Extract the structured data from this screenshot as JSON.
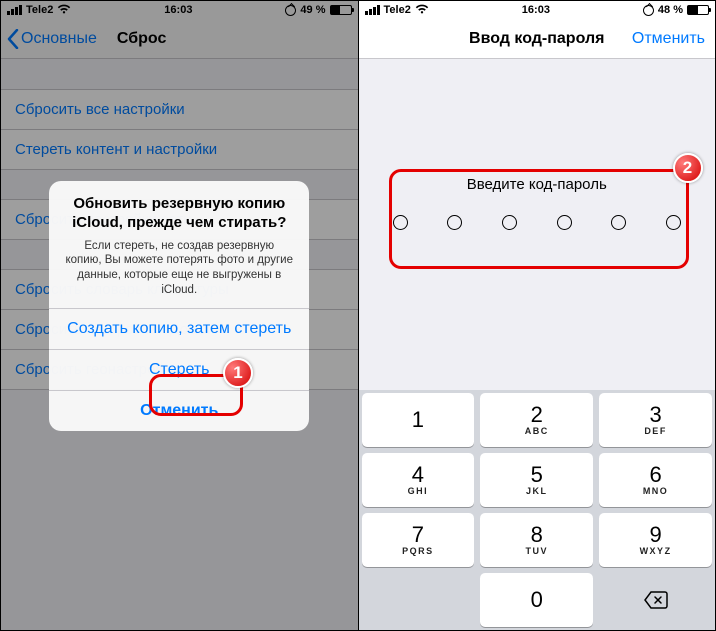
{
  "left": {
    "status": {
      "carrier": "Tele2",
      "time": "16:03",
      "battery_pct": "49 %"
    },
    "nav": {
      "back": "Основные",
      "title": "Сброс"
    },
    "list": {
      "group1": [
        "Сбросить все настройки",
        "Стереть контент и настройки"
      ],
      "group2": [
        "Сбросить настройки сети"
      ],
      "group3": [
        "Сбросить словарь клавиатуры",
        "Сбросить настройки «Домой»",
        "Сбросить геонастройки"
      ]
    },
    "sheet": {
      "title": "Обновить резервную копию iCloud, прежде чем стирать?",
      "body": "Если стереть, не создав резервную копию, Вы можете потерять фото и другие данные, которые еще не выгружены в iCloud.",
      "backup": "Создать копию, затем стереть",
      "erase": "Стереть",
      "cancel": "Отменить"
    },
    "badge": "1"
  },
  "right": {
    "status": {
      "carrier": "Tele2",
      "time": "16:03",
      "battery_pct": "48 %"
    },
    "nav": {
      "title": "Ввод код-пароля",
      "cancel": "Отменить"
    },
    "prompt": "Введите код-пароль",
    "badge": "2",
    "keys": [
      {
        "n": "1",
        "l": ""
      },
      {
        "n": "2",
        "l": "ABC"
      },
      {
        "n": "3",
        "l": "DEF"
      },
      {
        "n": "4",
        "l": "GHI"
      },
      {
        "n": "5",
        "l": "JKL"
      },
      {
        "n": "6",
        "l": "MNO"
      },
      {
        "n": "7",
        "l": "PQRS"
      },
      {
        "n": "8",
        "l": "TUV"
      },
      {
        "n": "9",
        "l": "WXYZ"
      },
      {
        "n": "0",
        "l": ""
      }
    ]
  }
}
